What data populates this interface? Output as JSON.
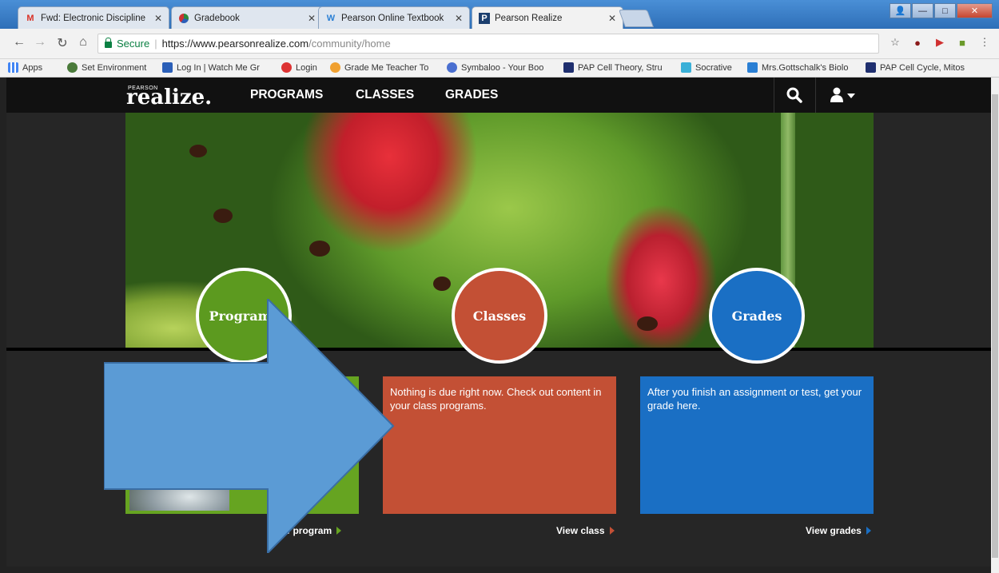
{
  "browser": {
    "tabs": [
      {
        "label": "Fwd: Electronic Discipline",
        "icon": "gmail-icon"
      },
      {
        "label": "Gradebook",
        "icon": "gradebook-icon"
      },
      {
        "label": "Pearson Online Textbook",
        "icon": "w-icon"
      },
      {
        "label": "Pearson Realize",
        "icon": "pearson-p-icon"
      }
    ],
    "secure_label": "Secure",
    "url_host": "https://www.pearsonrealize.com",
    "url_path": "/community/home",
    "bookmarks": [
      "Apps",
      "Set Environment",
      "Log In | Watch Me Gr",
      "Login",
      "Grade Me Teacher To",
      "Symbaloo - Your Boo",
      "PAP Cell Theory, Stru",
      "Socrative",
      "Mrs.Gottschalk's Biolo",
      "PAP Cell Cycle, Mitos"
    ]
  },
  "site": {
    "logo_small": "PEARSON",
    "logo": "realize.",
    "nav": [
      "PROGRAMS",
      "CLASSES",
      "GRADES"
    ]
  },
  "sections": {
    "programs": {
      "circle": "Programs",
      "link": "View program"
    },
    "classes": {
      "circle": "Classes",
      "text": "Nothing is due right now. Check out content in your class programs.",
      "link": "View class"
    },
    "grades": {
      "circle": "Grades",
      "text": "After you finish an assignment or test, get your grade here.",
      "link": "View grades"
    }
  },
  "colors": {
    "programs": "#66a421",
    "classes": "#c35035",
    "grades": "#1a6fc4",
    "arrow": "#5b9bd5"
  }
}
